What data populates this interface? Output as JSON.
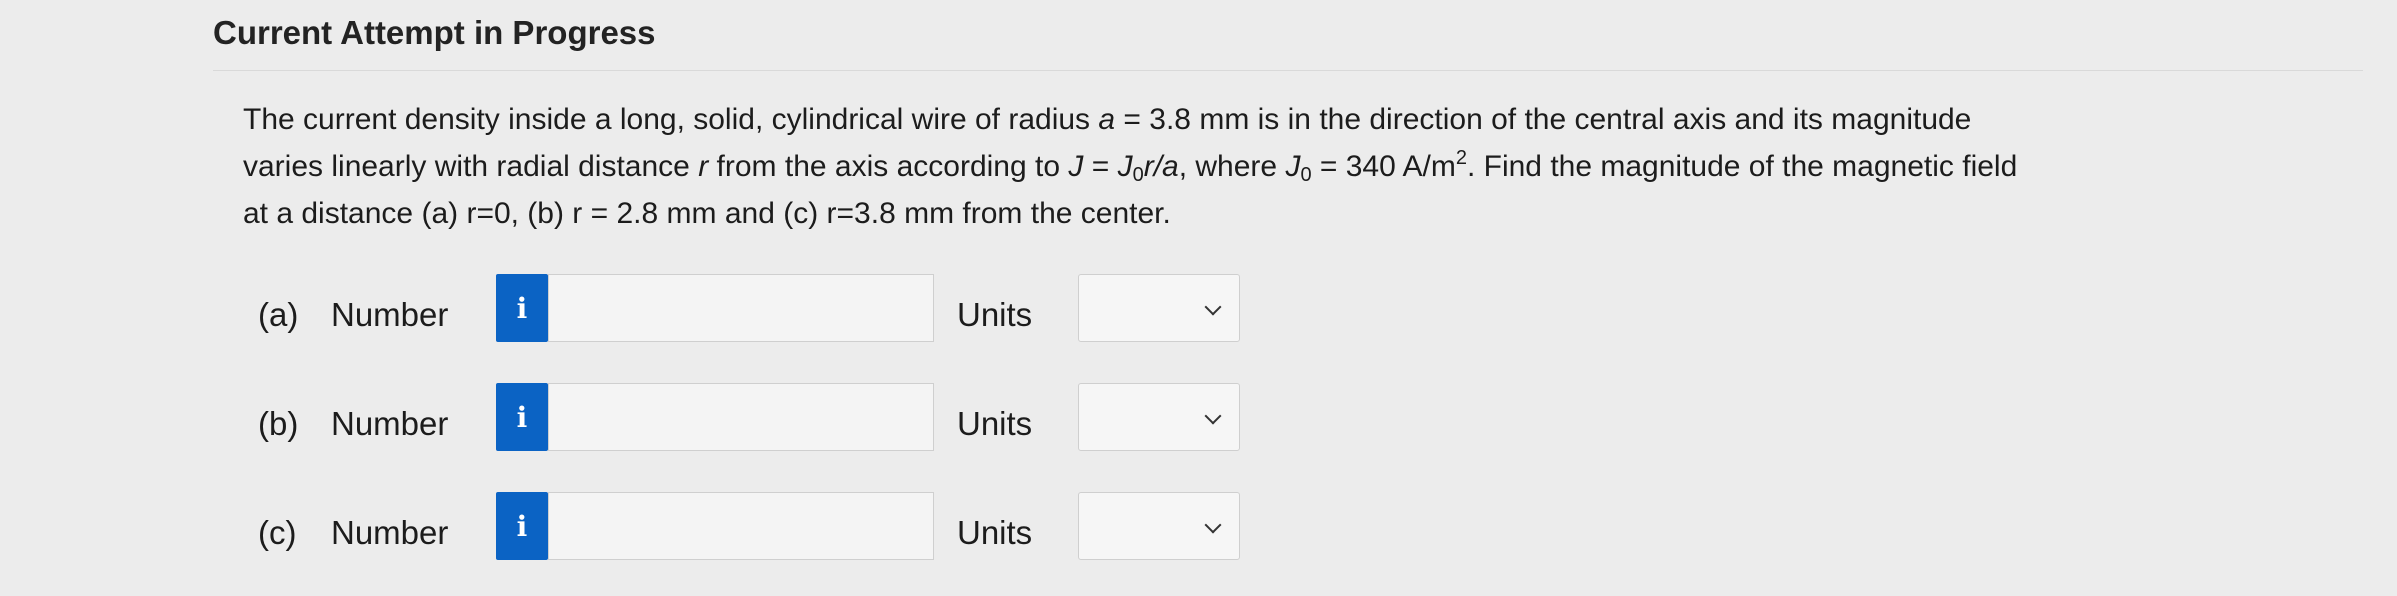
{
  "header": {
    "title": "Current Attempt in Progress"
  },
  "question": {
    "line1_a": "The current density inside a long, solid, cylindrical wire of radius ",
    "line1_var_a": "a",
    "line1_b": " = 3.8 mm is in the direction of the central axis and its magnitude",
    "line2_a": "varies linearly with radial distance ",
    "line2_var_r": "r",
    "line2_b": " from the axis according to ",
    "line2_J": "J",
    "line2_eq": " = ",
    "line2_J0": "J",
    "line2_J0_sub": "0",
    "line2_r_over_a": "r/a",
    "line2_c": ", where ",
    "line2_J0b": "J",
    "line2_J0b_sub": "0",
    "line2_d": " = 340 A/m",
    "line2_sup": "2",
    "line2_e": ". Find the magnitude of the magnetic field",
    "line3": "at a distance (a) r=0, (b) r = 2.8 mm and (c) r=3.8 mm from the center."
  },
  "parts": [
    {
      "label": "(a)",
      "number_label": "Number",
      "info_icon": "i",
      "value": "",
      "units_label": "Units",
      "units_value": ""
    },
    {
      "label": "(b)",
      "number_label": "Number",
      "info_icon": "i",
      "value": "",
      "units_label": "Units",
      "units_value": ""
    },
    {
      "label": "(c)",
      "number_label": "Number",
      "info_icon": "i",
      "value": "",
      "units_label": "Units",
      "units_value": ""
    }
  ],
  "colors": {
    "info_button": "#0b63c4",
    "background": "#ececec"
  }
}
